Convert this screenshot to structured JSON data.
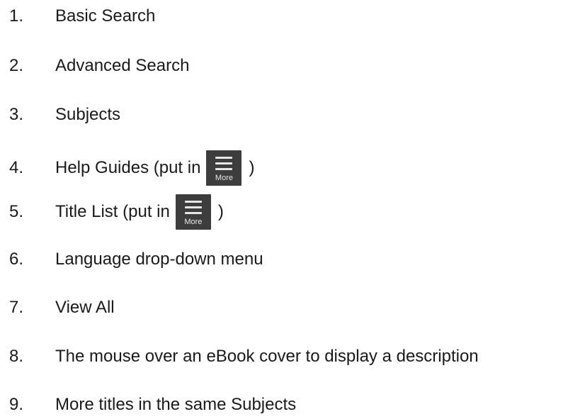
{
  "items": [
    {
      "num": "1.",
      "text": "Basic Search"
    },
    {
      "num": "2.",
      "text": "Advanced Search"
    },
    {
      "num": "3.",
      "text": "Subjects"
    },
    {
      "num": "4.",
      "text_before": "Help Guides (put in",
      "text_after": ")"
    },
    {
      "num": "5.",
      "text_before": "Title List (put in",
      "text_after": ")"
    },
    {
      "num": "6.",
      "text": "Language drop-down menu"
    },
    {
      "num": "7.",
      "text": "View All"
    },
    {
      "num": "8.",
      "text": "The mouse over an eBook cover to display a description"
    },
    {
      "num": "9.",
      "text": "More titles in the same Subjects"
    }
  ],
  "more_button": {
    "label": "More",
    "icon": "hamburger-menu-icon",
    "background": "#3d3d3d"
  }
}
